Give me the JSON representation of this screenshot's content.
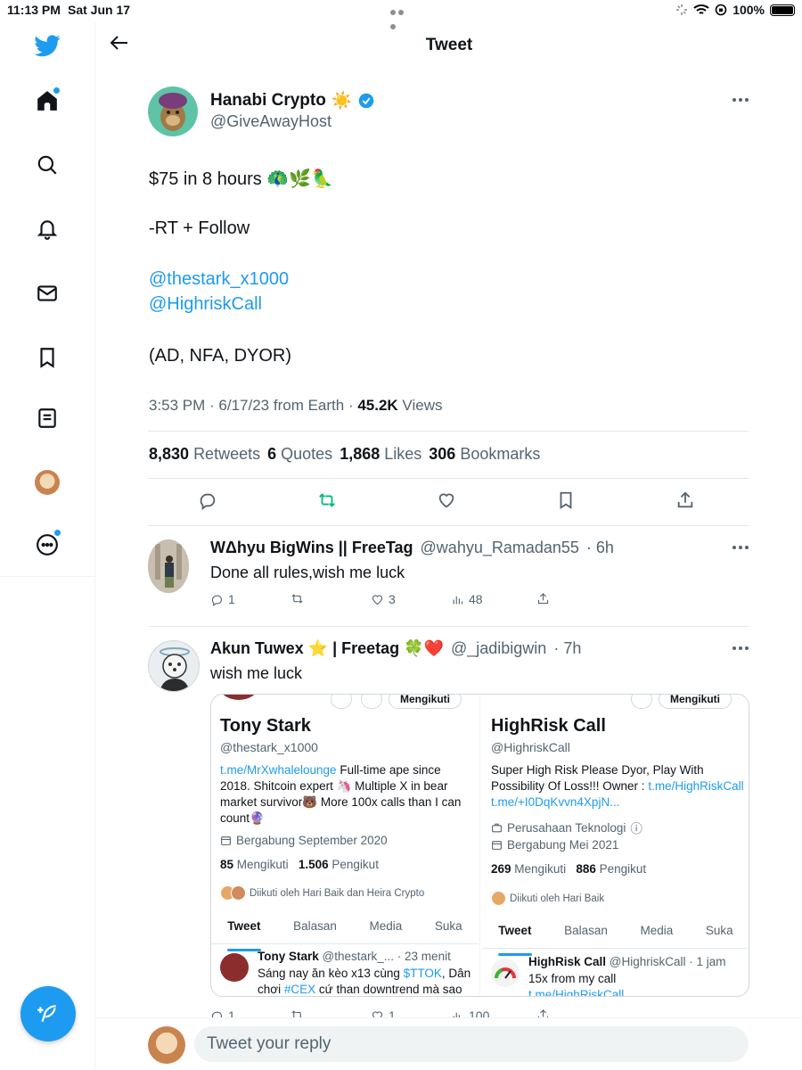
{
  "status_bar": {
    "time": "11:13 PM",
    "date": "Sat Jun 17",
    "battery": "100%"
  },
  "header": {
    "title": "Tweet"
  },
  "tweet": {
    "author_name": "Hanabi Crypto",
    "author_emoji": "☀️",
    "author_handle": "@GiveAwayHost",
    "line1": "$75 in 8 hours 🦚🌿🦜",
    "line2": "-RT + Follow",
    "mention1": "@thestark_x1000",
    "mention2": "@HighriskCall",
    "line3": "(AD, NFA, DYOR)",
    "meta_time": "3:53 PM · 6/17/23 from Earth · ",
    "views_count": "45.2K",
    "views_label": " Views",
    "stats": {
      "retweets_count": "8,830",
      "retweets_label": "Retweets",
      "quotes_count": "6",
      "quotes_label": "Quotes",
      "likes_count": "1,868",
      "likes_label": "Likes",
      "bookmarks_count": "306",
      "bookmarks_label": "Bookmarks"
    }
  },
  "replies": [
    {
      "name": "WΔhyu BigWins || FreeTag",
      "handle": "@wahyu_Ramadan55",
      "time": "· 6h",
      "text": "Done all rules,wish me luck",
      "reply_count": "1",
      "like_count": "3",
      "view_count": "48"
    },
    {
      "name": "Akun Tuwex ⭐ | Freetag 🍀❤️",
      "handle": "@_jadibigwin",
      "time": "· 7h",
      "text": "wish me luck",
      "reply_count": "1",
      "like_count": "1",
      "view_count": "100"
    }
  ],
  "screenshot": {
    "left": {
      "follow_btn": "Mengikuti",
      "name": "Tony Stark",
      "handle": "@thestark_x1000",
      "bio_link": "t.me/MrXwhalelounge",
      "bio_text": " Full-time ape since 2018. Shitcoin expert 🦄 Multiple X in bear market survivor🐻 More 100x calls than I can count🔮",
      "joined": "Bergabung September 2020",
      "following_count": "85",
      "following_label": "Mengikuti",
      "followers_count": "1.506",
      "followers_label": "Pengikut",
      "followed_by": "Diikuti oleh Hari Baik dan Heira Crypto",
      "tabs": [
        "Tweet",
        "Balasan",
        "Media",
        "Suka"
      ],
      "tweet_name": "Tony Stark",
      "tweet_handle": "@thestark_...",
      "tweet_time": "· 23 menit",
      "tweet_text_1": "Sáng nay ăn kèo x13 cùng ",
      "tweet_cashtag": "$TTOK",
      "tweet_text_2": ", Dân chơi ",
      "tweet_hashtag": "#CEX",
      "tweet_text_3": " cứ than downtrend mà sao"
    },
    "right": {
      "follow_btn": "Mengikuti",
      "name": "HighRisk Call",
      "handle": "@HighriskCall",
      "bio_text": "Super High Risk Please Dyor, Play With Possibility Of Loss!!! Owner : ",
      "bio_link1": "t.me/HighRiskCall",
      "bio_link2": " t.me/+I0DqKvvn4XpjN...",
      "category": "Perusahaan Teknologi",
      "joined": "Bergabung Mei 2021",
      "following_count": "269",
      "following_label": "Mengikuti",
      "followers_count": "886",
      "followers_label": "Pengikut",
      "followed_by": "Diikuti oleh Hari Baik",
      "tabs": [
        "Tweet",
        "Balasan",
        "Media",
        "Suka"
      ],
      "tweet_name": "HighRisk Call",
      "tweet_handle": "@HighriskCall",
      "tweet_time": "· 1 jam",
      "tweet_text": "15x from my call",
      "tweet_link": "t.me/HighRiskCall"
    }
  },
  "reply_box": {
    "placeholder": "Tweet your reply"
  },
  "colors": {
    "accent": "#1d9bf0",
    "retweet": "#00ba7c",
    "text_secondary": "#536471"
  }
}
